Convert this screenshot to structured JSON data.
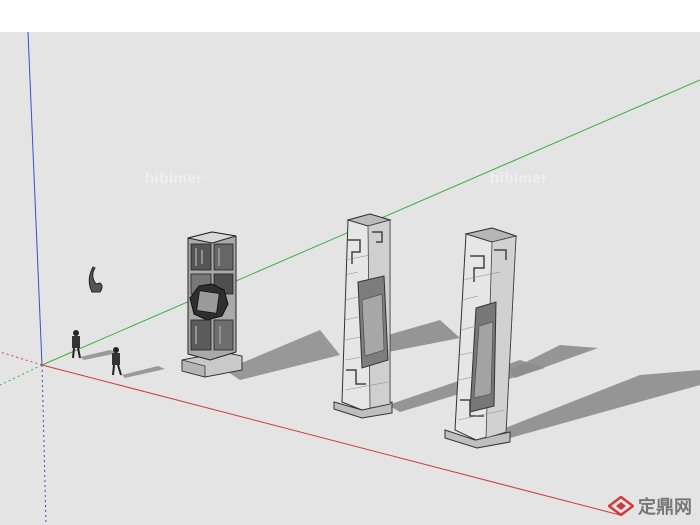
{
  "viewport": {
    "name": "SketchUp model viewport",
    "axis_colors": {
      "red": "#d23b3b",
      "green": "#3fae3f",
      "blue": "#3a4fd0"
    },
    "sky_color": "#ffffff",
    "ground_color": "#e4e4e4"
  },
  "watermarks": {
    "left": "hibimer",
    "right": "hibimer"
  },
  "logo": {
    "text": "定鼎网",
    "icon": "site-logo-icon"
  }
}
